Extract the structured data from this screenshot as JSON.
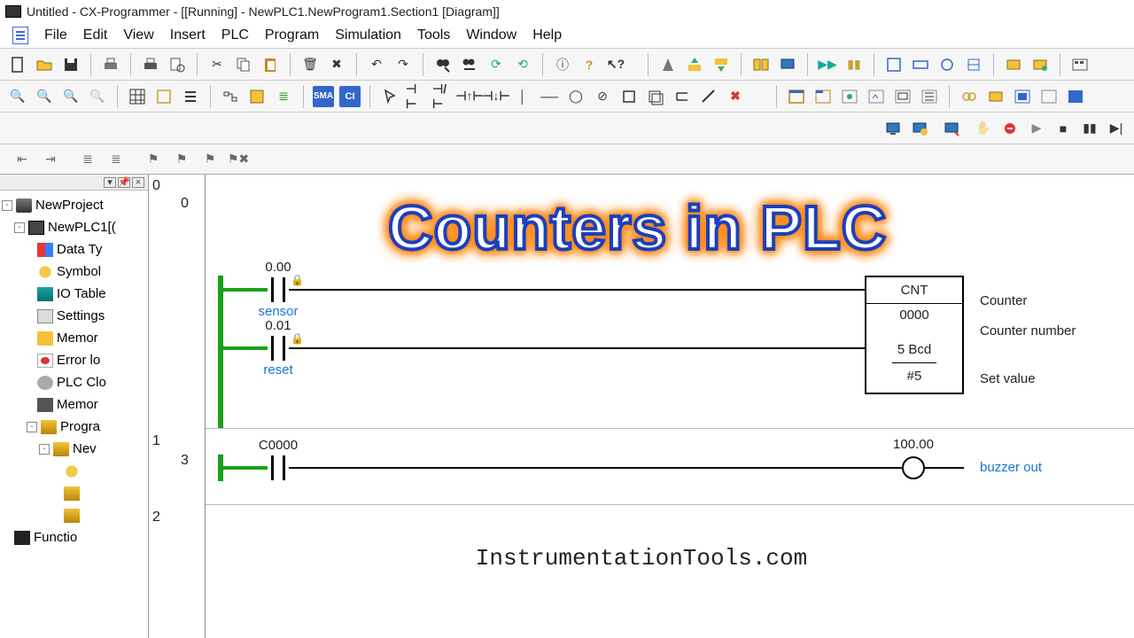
{
  "window": {
    "title": "Untitled - CX-Programmer - [[Running] - NewPLC1.NewProgram1.Section1 [Diagram]]"
  },
  "menu": {
    "items": [
      "File",
      "Edit",
      "View",
      "Insert",
      "PLC",
      "Program",
      "Simulation",
      "Tools",
      "Window",
      "Help"
    ]
  },
  "tree": {
    "root": "NewProject",
    "nodes": [
      {
        "label": "NewPLC1[(",
        "icon": "plc",
        "depth": 1,
        "toggle": "-"
      },
      {
        "label": "Data Ty",
        "icon": "dt",
        "depth": 2
      },
      {
        "label": "Symbol",
        "icon": "sym",
        "depth": 2
      },
      {
        "label": "IO Table",
        "icon": "io",
        "depth": 2
      },
      {
        "label": "Settings",
        "icon": "set",
        "depth": 2
      },
      {
        "label": "Memor",
        "icon": "mem",
        "depth": 2
      },
      {
        "label": "Error lo",
        "icon": "err",
        "depth": 2
      },
      {
        "label": "PLC Clo",
        "icon": "clk",
        "depth": 2
      },
      {
        "label": "Memor",
        "icon": "chip",
        "depth": 2
      },
      {
        "label": "Progra",
        "icon": "prg",
        "depth": 2,
        "toggle": "-"
      },
      {
        "label": "Nev",
        "icon": "prg",
        "depth": 3,
        "toggle": "-"
      },
      {
        "label": "",
        "icon": "sym",
        "depth": 4
      },
      {
        "label": "",
        "icon": "sec",
        "depth": 4
      },
      {
        "label": "",
        "icon": "sec",
        "depth": 4
      },
      {
        "label": "Functio",
        "icon": "fn",
        "depth": 1
      }
    ]
  },
  "ladder": {
    "rungs": [
      {
        "outer": "0",
        "inner": "0",
        "lines": [
          {
            "addr": "0.00",
            "name": "sensor"
          },
          {
            "addr": "0.01",
            "name": "reset"
          }
        ],
        "block": {
          "title": "CNT",
          "rows": [
            "0000",
            "5 Bcd",
            "#5"
          ],
          "side_labels": [
            "Counter",
            "Counter number",
            "Set value"
          ]
        }
      },
      {
        "outer": "1",
        "inner": "3",
        "contact": {
          "addr": "C0000"
        },
        "coil": {
          "addr": "100.00",
          "name": "buzzer out"
        }
      },
      {
        "outer": "2"
      }
    ]
  },
  "overlay": {
    "title": "Counters in PLC",
    "watermark": "InstrumentationTools.com"
  }
}
